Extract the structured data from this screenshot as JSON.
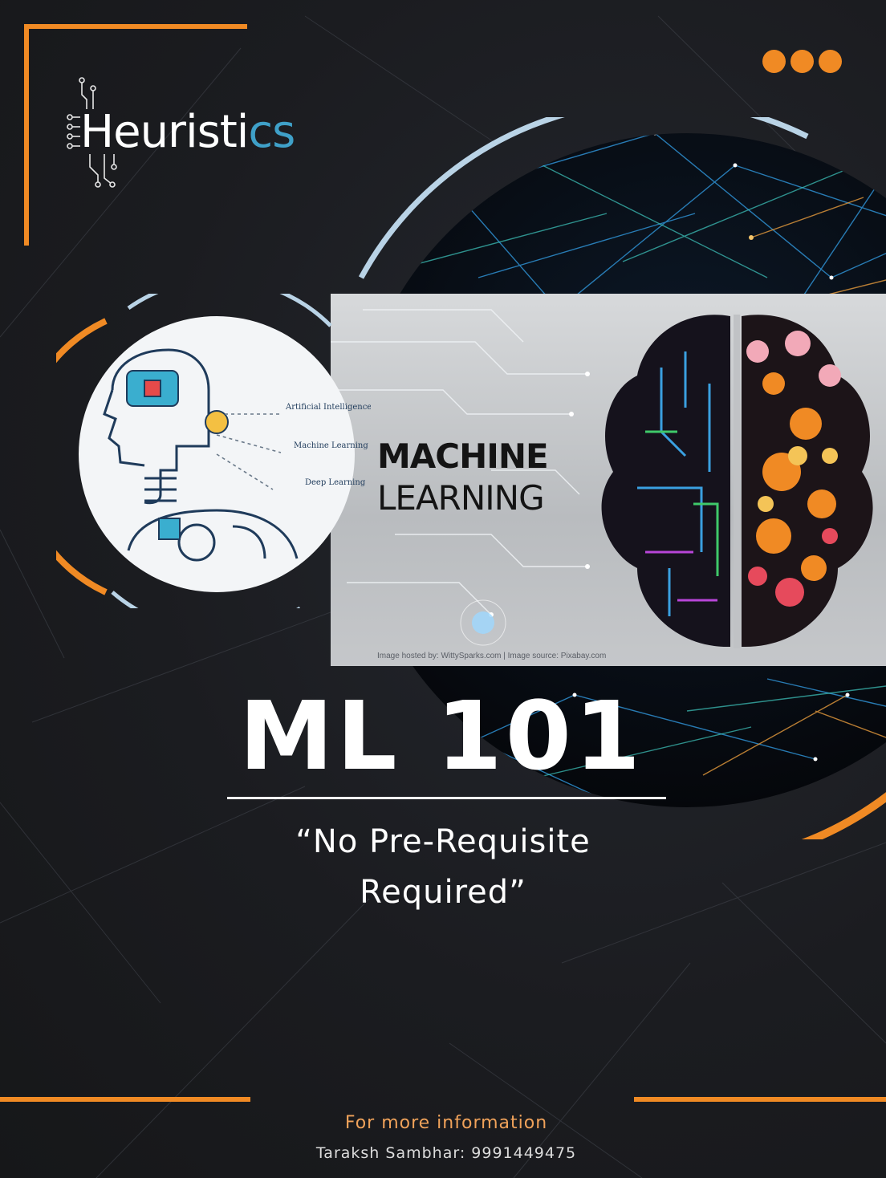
{
  "brand": {
    "logo_text_main": "Heuristi",
    "logo_text_highlight": "cs",
    "accent": "#f08a24",
    "logo_highlight_color": "#3fa0c8"
  },
  "header": {
    "menu_icon": "more-dots-icon"
  },
  "illustration": {
    "labels": [
      "Artificial Intelligence",
      "Machine Learning",
      "Deep Learning"
    ],
    "icon": "robot-head-icon"
  },
  "banner": {
    "title_line1": "MACHINE",
    "title_line2": "LEARNING",
    "credit": "Image hosted by: WittySparks.com | Image source: Pixabay.com",
    "image": "brain-circuit-icon"
  },
  "course": {
    "title": "ML 101",
    "subtitle_line1": "“No Pre-Requisite",
    "subtitle_line2": "Required”"
  },
  "footer": {
    "heading": "For more information",
    "contact": "Taraksh Sambhar: 9991449475"
  }
}
